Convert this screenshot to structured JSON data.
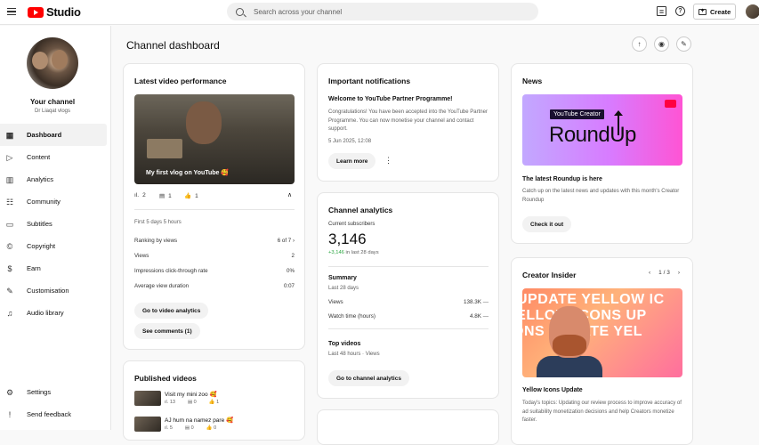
{
  "topbar": {
    "logo_text": "Studio",
    "search_placeholder": "Search across your channel",
    "create_label": "Create"
  },
  "sidebar": {
    "channel_title": "Your channel",
    "channel_name": "Dr Liaqat vlogs",
    "items": [
      {
        "label": "Dashboard",
        "icon": "dashboard-icon"
      },
      {
        "label": "Content",
        "icon": "content-icon"
      },
      {
        "label": "Analytics",
        "icon": "analytics-icon"
      },
      {
        "label": "Community",
        "icon": "community-icon"
      },
      {
        "label": "Subtitles",
        "icon": "subtitles-icon"
      },
      {
        "label": "Copyright",
        "icon": "copyright-icon"
      },
      {
        "label": "Earn",
        "icon": "earn-icon"
      },
      {
        "label": "Customisation",
        "icon": "customisation-icon"
      },
      {
        "label": "Audio library",
        "icon": "audio-library-icon"
      }
    ],
    "bottom_items": [
      {
        "label": "Settings",
        "icon": "settings-icon"
      },
      {
        "label": "Send feedback",
        "icon": "feedback-icon"
      }
    ]
  },
  "main": {
    "title": "Channel dashboard"
  },
  "latest": {
    "title": "Latest video performance",
    "video_title": "My first vlog on YouTube 🥰",
    "views_count": "2",
    "comments_count": "1",
    "likes_count": "1",
    "period": "First 5 days 5 hours",
    "metrics": [
      {
        "label": "Ranking by views",
        "value": "6 of 7"
      },
      {
        "label": "Views",
        "value": "2"
      },
      {
        "label": "Impressions click-through rate",
        "value": "0%"
      },
      {
        "label": "Average view duration",
        "value": "0:07"
      }
    ],
    "analytics_button": "Go to video analytics",
    "comments_button": "See comments (1)"
  },
  "published": {
    "title": "Published videos",
    "videos": [
      {
        "title": "Visit my mini zoo 🥰",
        "views": "13",
        "comments": "0",
        "likes": "1"
      },
      {
        "title": "AJ hum na namez pare 🥰",
        "views": "5",
        "comments": "0",
        "likes": "0"
      }
    ]
  },
  "notifications": {
    "title": "Important notifications",
    "headline": "Welcome to YouTube Partner Programme!",
    "body": "Congratulations! You have been accepted into the YouTube Partner Programme. You can now monetise your channel and contact support.",
    "date": "5 Jun 2025, 12:08",
    "learn_more": "Learn more"
  },
  "analytics": {
    "title": "Channel analytics",
    "subs_label": "Current subscribers",
    "subs_value": "3,146",
    "delta_value": "+3,146",
    "delta_period": "in last 28 days",
    "summary_title": "Summary",
    "summary_period": "Last 28 days",
    "rows": [
      {
        "label": "Views",
        "value": "138.3K"
      },
      {
        "label": "Watch time (hours)",
        "value": "4.8K"
      }
    ],
    "top_videos_title": "Top videos",
    "top_videos_period": "Last 48 hours · Views",
    "button": "Go to channel analytics"
  },
  "news": {
    "title": "News",
    "image_tag": "YouTube Creator",
    "image_big": "RoundUp",
    "headline": "The latest Roundup is here",
    "desc": "Catch up on the latest news and updates with this month's Creator Roundup",
    "button": "Check it out"
  },
  "insider": {
    "title": "Creator Insider",
    "pager": "1 / 3",
    "image_lines": [
      "UPDATE YELLOW IC",
      "YELLOW ICONS UP",
      "ICONS UPDATE YEL"
    ],
    "headline": "Yellow Icons Update",
    "desc": "Today's topics: Updating our review process to improve accuracy of ad suitability monetization decisions and help Creators monetize faster."
  }
}
